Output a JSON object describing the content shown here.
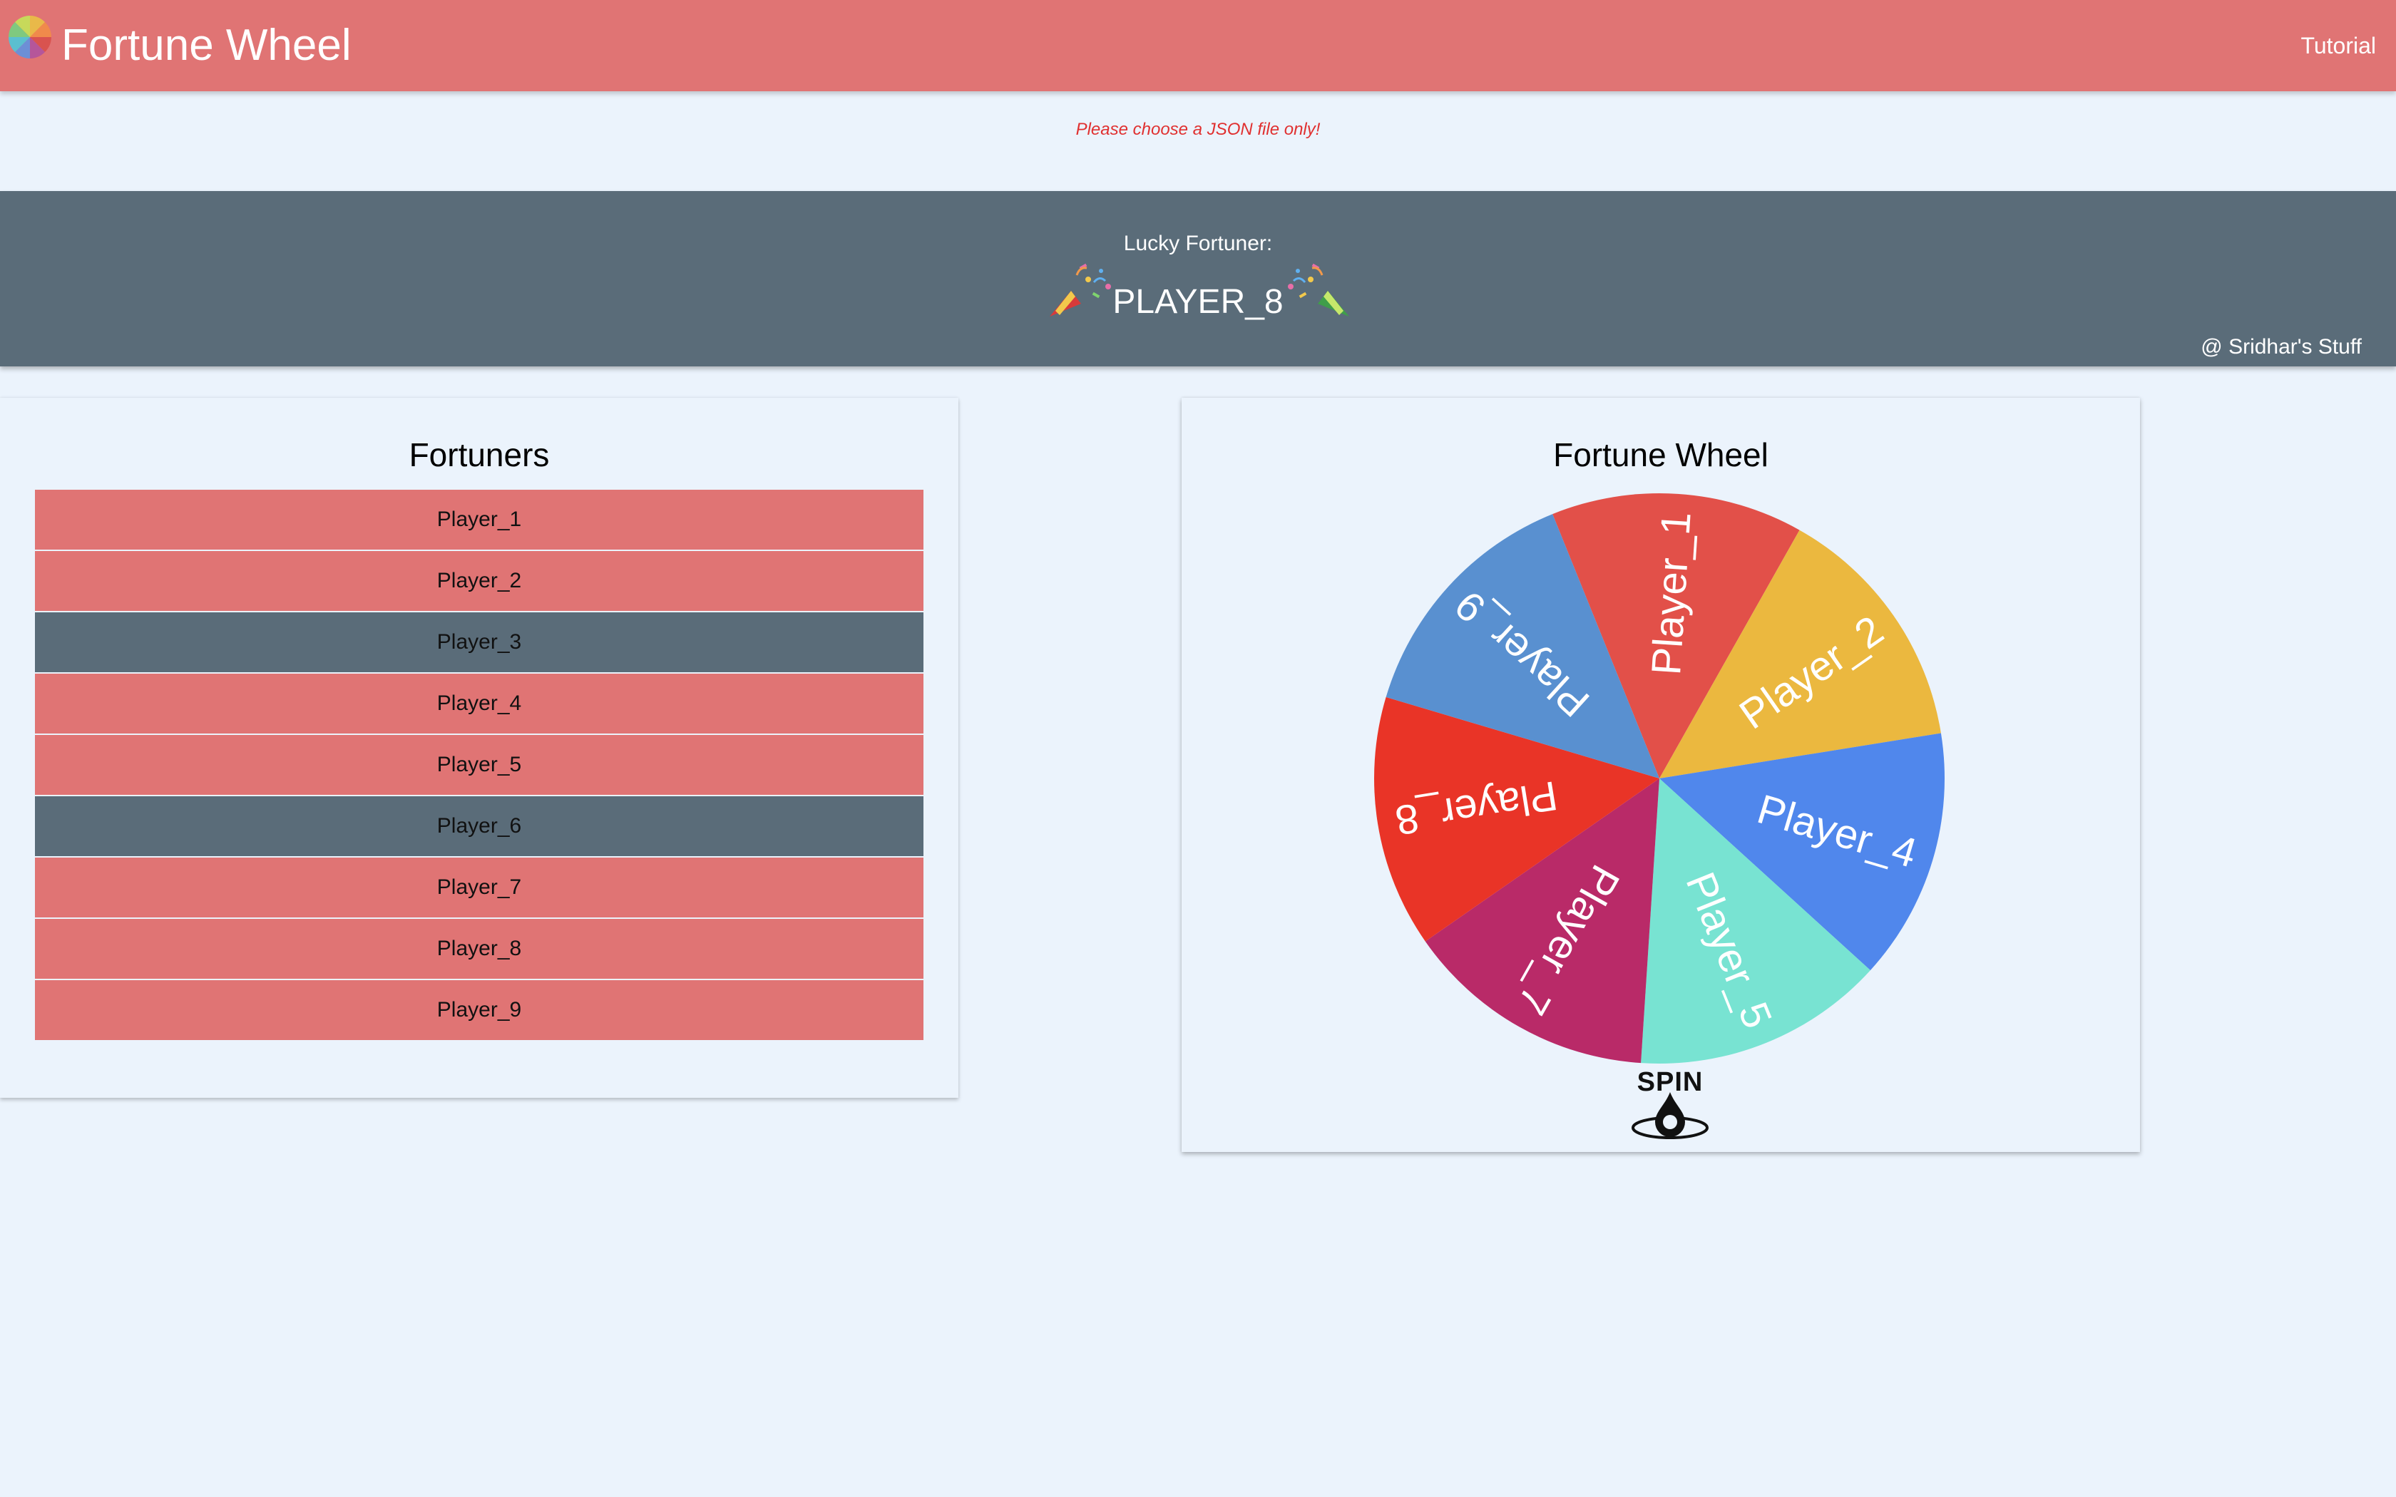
{
  "header": {
    "title": "Fortune Wheel",
    "tutorial_label": "Tutorial",
    "logo_icon": "color-wheel-logo"
  },
  "upload": {
    "error_message": "Please choose a JSON file only!"
  },
  "banner": {
    "label": "Lucky Fortuner:",
    "winner": "PLAYER_8",
    "credit": "@ Sridhar's Stuff",
    "left_icon": "party-popper-icon",
    "right_icon": "party-popper-icon"
  },
  "fortuners": {
    "title": "Fortuners",
    "players": [
      {
        "name": "Player_1",
        "state": "active"
      },
      {
        "name": "Player_2",
        "state": "active"
      },
      {
        "name": "Player_3",
        "state": "eliminated"
      },
      {
        "name": "Player_4",
        "state": "active"
      },
      {
        "name": "Player_5",
        "state": "active"
      },
      {
        "name": "Player_6",
        "state": "eliminated"
      },
      {
        "name": "Player_7",
        "state": "active"
      },
      {
        "name": "Player_8",
        "state": "active"
      },
      {
        "name": "Player_9",
        "state": "active"
      }
    ]
  },
  "wheel": {
    "title": "Fortune Wheel",
    "spin_label": "SPIN",
    "segments": [
      {
        "label": "Player_1",
        "color": "#e25049"
      },
      {
        "label": "Player_2",
        "color": "#ebb83f"
      },
      {
        "label": "Player_4",
        "color": "#5087ec"
      },
      {
        "label": "Player_5",
        "color": "#78e3d2"
      },
      {
        "label": "Player_7",
        "color": "#b92a68"
      },
      {
        "label": "Player_8",
        "color": "#e93427"
      },
      {
        "label": "Player_9",
        "color": "#5990d0"
      }
    ]
  },
  "colors": {
    "accent": "#e07474",
    "banner": "#5a6c79",
    "background": "#ebf3fc",
    "eliminated": "#5a6c79",
    "error": "#e03030"
  }
}
